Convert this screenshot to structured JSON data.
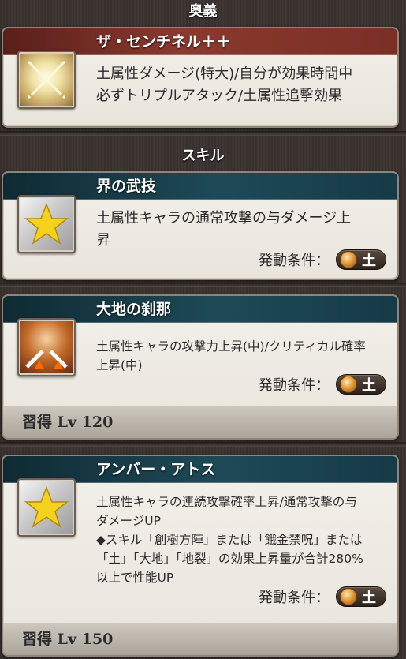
{
  "sections": {
    "ougi": "奥義",
    "skill": "スキル"
  },
  "ougi": {
    "name": "ザ・センチネル＋＋",
    "desc_line1": "土属性ダメージ(特大)/自分が効果時間中",
    "desc_line2": "必ずトリプルアタック/土属性追撃効果",
    "icon": "crossed-swords-icon"
  },
  "skills": [
    {
      "name": "界の武技",
      "desc_line1": "土属性キャラの通常攻撃の与ダメージ上",
      "desc_line2": "昇",
      "cond_label": "発動条件：",
      "cond_element": "土",
      "icon": "star-icon"
    },
    {
      "name": "大地の刹那",
      "desc_line1": "土属性キャラの攻撃力上昇(中)/クリティカル確率",
      "desc_line2": "上昇(中)",
      "cond_label": "発動条件：",
      "cond_element": "土",
      "learn": "習得 Lv 120",
      "icon": "sword-burst-icon"
    },
    {
      "name": "アンバー・アトス",
      "desc_line1": "土属性キャラの連続攻撃確率上昇/通常攻撃の与",
      "desc_line2": "ダメージUP",
      "desc_line3": "◆スキル「創樹方陣」または「餓金禁呪」または",
      "desc_line4": "「土」「大地」「地裂」の効果上昇量が合計280%",
      "desc_line5": "以上で性能UP",
      "cond_label": "発動条件：",
      "cond_element": "土",
      "learn": "習得 Lv 150",
      "icon": "star-icon"
    }
  ],
  "colors": {
    "ougi_header": "#7a2f26",
    "skill_header": "#1e4a58",
    "earth_orb": "#e39a38"
  }
}
